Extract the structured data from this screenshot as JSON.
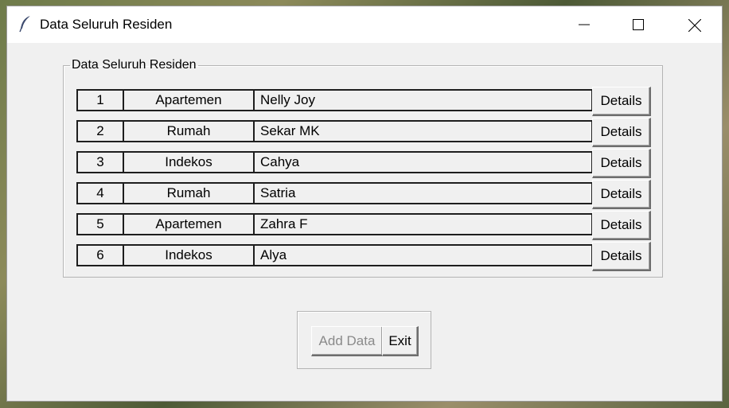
{
  "window": {
    "title": "Data Seluruh Residen",
    "icon": "feather-icon",
    "controls": [
      "minimize-icon",
      "maximize-icon",
      "close-icon"
    ]
  },
  "group": {
    "title": "Data Seluruh Residen"
  },
  "residents": [
    {
      "no": "1",
      "type": "Apartemen",
      "name": "Nelly Joy",
      "action": "Details"
    },
    {
      "no": "2",
      "type": "Rumah",
      "name": "Sekar MK",
      "action": "Details"
    },
    {
      "no": "3",
      "type": "Indekos",
      "name": "Cahya",
      "action": "Details"
    },
    {
      "no": "4",
      "type": "Rumah",
      "name": "Satria",
      "action": "Details"
    },
    {
      "no": "5",
      "type": "Apartemen",
      "name": "Zahra F",
      "action": "Details"
    },
    {
      "no": "6",
      "type": "Indekos",
      "name": "Alya",
      "action": "Details"
    }
  ],
  "buttons": {
    "add_label": "Add Data",
    "exit_label": "Exit"
  },
  "colors": {
    "window_bg": "#f0f0f0",
    "titlebar_bg": "#ffffff",
    "disabled_text": "#8a8a8a"
  }
}
